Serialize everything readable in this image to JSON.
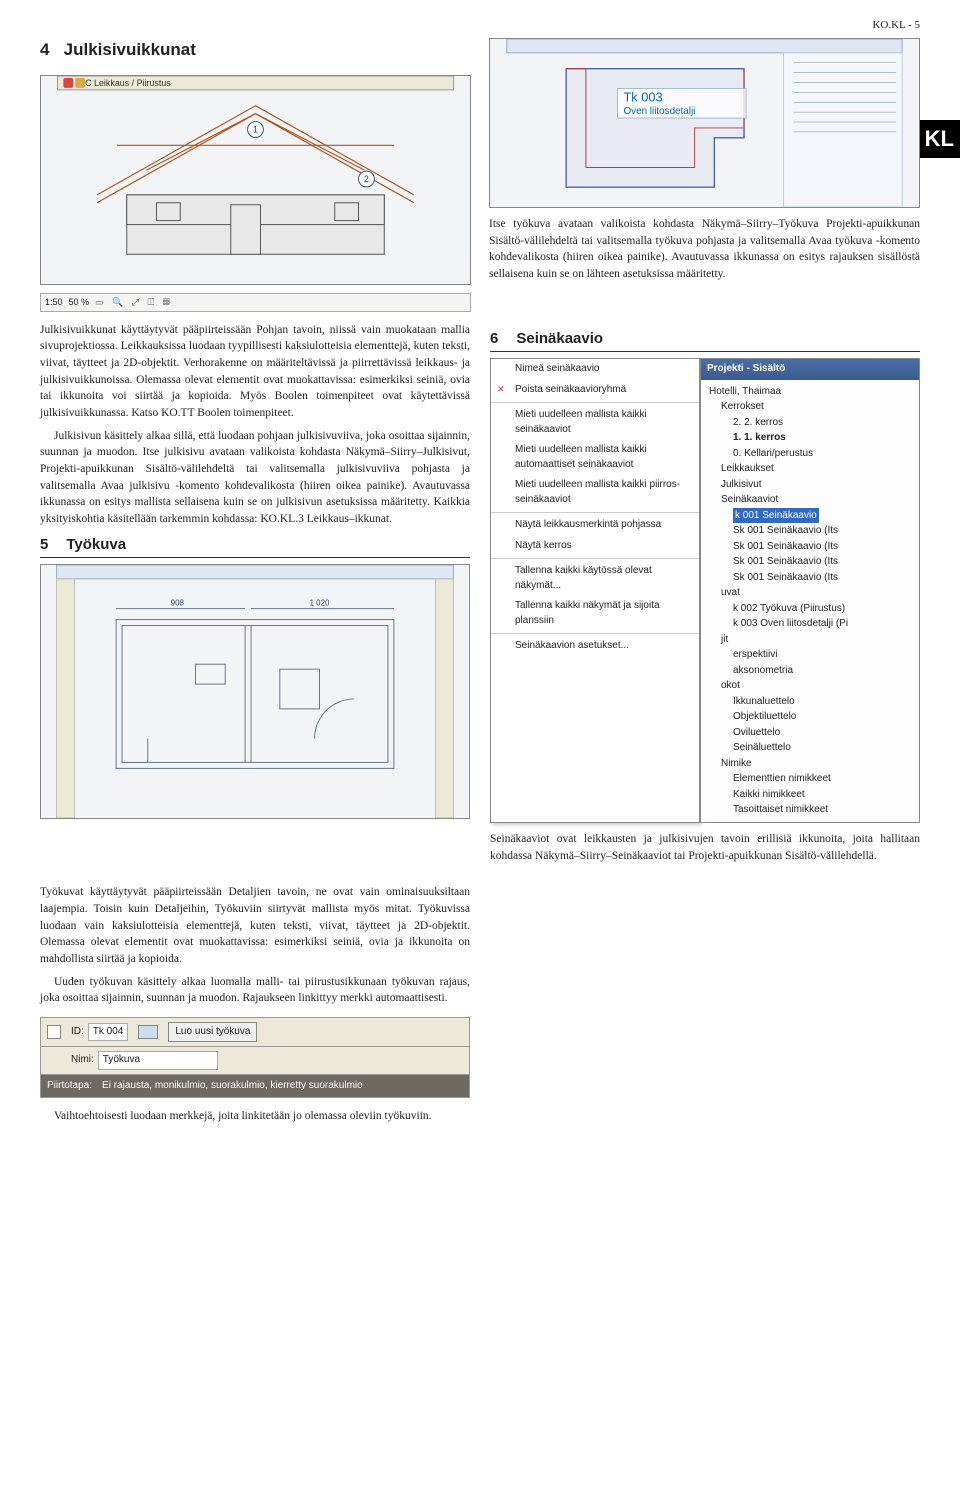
{
  "page_header": "KO.KL - 5",
  "side_tab": "KL",
  "sections": {
    "s4": {
      "num": "4",
      "title": "Julkisivuikkunat"
    },
    "s5": {
      "num": "5",
      "title": "Työkuva"
    },
    "s6": {
      "num": "6",
      "title": "Seinäkaavio"
    }
  },
  "fig_top_left": {
    "title_bar": "C Leikkaus / Piirustus",
    "balloons": [
      "1",
      "2"
    ],
    "scale_toolbar": {
      "scale": "1:50",
      "zoom": "50 %"
    }
  },
  "fig_top_right": {
    "label_title": "Tk 003",
    "label_sub": "Oven liitosdetalji"
  },
  "para_right_1": "Itse työkuva avataan valikoista kohdasta Näkymä–Siirry–Työkuva Projekti-apuikkunan Sisältö-välilehdeltä tai valitsemalla työkuva pohjasta ja valitsemalla Avaa työkuva -komento kohdevalikosta (hiiren oikea painike). Avautuvassa ikkunassa on esitys rajauksen sisällöstä sellaisena kuin se on lähteen asetuksissa määritetty.",
  "para_left_1": "Julkisivuikkunat käyttäytyvät pääpiirteissään Pohjan tavoin, niissä vain muokataan mallia sivuprojektiossa. Leikkauksissa luodaan tyypillisesti kaksiulotteisia elementtejä, kuten teksti, viivat, täytteet ja 2D-objektit. Verhorakenne on määriteltävissä ja piirrettävissä leikkaus- ja julkisivuikkunoissa. Olemassa olevat elementit ovat muokattavissa: esimerkiksi seiniä, ovia tai ikkunoita voi siirtää ja kopioida. Myös Boolen toimenpiteet ovat käytettävissä julkisivuikkunassa. Katso KO.TT Boolen toimenpiteet.",
  "para_left_2": "Julkisivun käsittely alkaa sillä, että luodaan pohjaan julkisivuviiva, joka osoittaa sijainnin, suunnan ja muodon. Itse julkisivu avataan valikoista kohdasta Näkymä–Siirry–Julkisivut, Projekti-apuikkunan Sisältö-välilehdeltä tai valitsemalla julkisivuviiva pohjasta ja valitsemalla Avaa julkisivu -komento kohdevalikosta (hiiren oikea painike). Avautuvassa ikkunassa on esitys mallista sellaisena kuin se on julkisivun asetuksissa määritetty. Kaikkia yksityiskohtia käsitellään tarkemmin kohdassa: KO.KL.3 Leikkaus–ikkunat.",
  "fig_plan": {
    "dims": [
      "908",
      "1 020"
    ]
  },
  "tree_panel": {
    "title": "Projekti - Sisältö",
    "items": [
      {
        "t": "Hotelli, Thaimaa",
        "lvl": 0
      },
      {
        "t": "Kerrokset",
        "lvl": 1
      },
      {
        "t": "2. 2. kerros",
        "lvl": 2
      },
      {
        "t": "1. 1. kerros",
        "lvl": 2,
        "bold": true
      },
      {
        "t": "0. Kellari/perustus",
        "lvl": 2
      },
      {
        "t": "Leikkaukset",
        "lvl": 1
      },
      {
        "t": "Julkisivut",
        "lvl": 1
      },
      {
        "t": "Seinäkaaviot",
        "lvl": 1
      },
      {
        "t": "k 001 Seinäkaavio",
        "lvl": 2,
        "hl": true
      },
      {
        "t": "Sk 001 Seinäkaavio (Its",
        "lvl": 2
      },
      {
        "t": "Sk 001 Seinäkaavio (Its",
        "lvl": 2
      },
      {
        "t": "Sk 001 Seinäkaavio (Its",
        "lvl": 2
      },
      {
        "t": "Sk 001 Seinäkaavio (Its",
        "lvl": 2
      },
      {
        "t": "uvat",
        "lvl": 1
      },
      {
        "t": "k 002 Työkuva (Piirustus)",
        "lvl": 2
      },
      {
        "t": "k 003 Oven liitosdetalji (Pi",
        "lvl": 2
      },
      {
        "t": "jit",
        "lvl": 1
      },
      {
        "t": "erspektiivi",
        "lvl": 2
      },
      {
        "t": "aksonometria",
        "lvl": 2
      },
      {
        "t": "okot",
        "lvl": 1
      },
      {
        "t": "Ikkunaluettelo",
        "lvl": 2
      },
      {
        "t": "Objektiluettelo",
        "lvl": 2
      },
      {
        "t": "Oviluettelo",
        "lvl": 2
      },
      {
        "t": "Seinäluettelo",
        "lvl": 2
      },
      {
        "t": "Nimike",
        "lvl": 1
      },
      {
        "t": "Elementtien nimikkeet",
        "lvl": 2
      },
      {
        "t": "Kaikki nimikkeet",
        "lvl": 2
      },
      {
        "t": "Tasoittaiset nimikkeet",
        "lvl": 2
      }
    ]
  },
  "context_menu": {
    "items": [
      {
        "t": "Nimeä seinäkaavio"
      },
      {
        "t": "Poista seinäkaavioryhmä",
        "icon": true
      },
      {
        "sep": true
      },
      {
        "t": "Mieti uudelleen mallista kaikki seinäkaaviot"
      },
      {
        "t": "Mieti uudelleen mallista kaikki automaattiset seinäkaaviot"
      },
      {
        "t": "Mieti uudelleen mallista kaikki piirros-seinäkaaviot"
      },
      {
        "sep": true
      },
      {
        "t": "Näytä leikkausmerkintä pohjassa"
      },
      {
        "t": "Näytä kerros"
      },
      {
        "sep": true
      },
      {
        "t": "Tallenna kaikki käytössä olevat näkymät..."
      },
      {
        "t": "Tallenna kaikki näkymät ja sijoita planssiin"
      },
      {
        "sep": true
      },
      {
        "t": "Seinäkaavion asetukset..."
      }
    ]
  },
  "para_right_bottom": "Seinäkaaviot ovat leikkausten ja julkisivujen tavoin erillisiä ikkunoita, joita hallitaan kohdassa Näkymä–Siirry–Seinäkaaviot tai Projekti-apuikkunan Sisältö-välilehdellä.",
  "bottom_left_para_1": "Työkuvat käyttäytyvät pääpiirteissään Detaljien tavoin, ne ovat vain ominaisuuksiltaan laajempia. Toisin kuin Detaljeihin, Työkuviin siirtyvät mallista myös mitat. Työkuvissa luodaan vain kaksiulotteisia elementtejä, kuten teksti, viivat, täytteet ja 2D-objektit. Olemassa olevat elementit ovat muokattavissa: esimerkiksi seiniä, ovia ja ikkunoita on mahdollista siirtää ja kopioida.",
  "bottom_left_para_2": "Uuden työkuvan käsittely alkaa luomalla malli- tai piirustusikkunaan työkuvan rajaus, joka osoittaa sijainnin, suunnan ja muodon. Rajaukseen linkittyy merkki automaattisesti.",
  "dialog": {
    "id_label": "ID:",
    "id_value": "Tk 004",
    "name_label": "Nimi:",
    "name_value": "Työkuva",
    "button": "Luo uusi työkuva",
    "footer_label": "Piirtotapa:",
    "footer_value": "Ei rajausta, monikulmio, suorakulmio, kierretty suorakulmio"
  },
  "bottom_last": "Vaihtoehtoisesti luodaan merkkejä, joita linkitetään jo olemassa oleviin työkuviin."
}
